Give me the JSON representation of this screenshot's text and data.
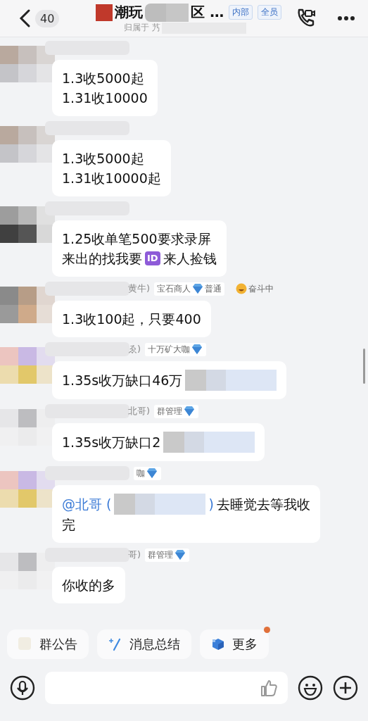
{
  "header": {
    "unread": "40",
    "title_start": "潮玩",
    "title_end": "区 …",
    "subtitle": "归属于 艿",
    "badges": [
      "内部",
      "全员"
    ]
  },
  "messages": [
    {
      "lines": [
        [
          {
            "kind": "text",
            "text": "1.3收5000起"
          }
        ],
        [
          {
            "kind": "text",
            "text": "1.31收10000"
          }
        ]
      ]
    },
    {
      "lines": [
        [
          {
            "kind": "text",
            "text": "1.3收5000起"
          }
        ],
        [
          {
            "kind": "text",
            "text": "1.31收10000起"
          }
        ]
      ]
    },
    {
      "lines": [
        [
          {
            "kind": "text",
            "text": "1.25收单笔500要求录屏"
          }
        ],
        [
          {
            "kind": "text",
            "text": "来出的找我要"
          },
          {
            "kind": "id",
            "text": "ID"
          },
          {
            "kind": "text",
            "text": "来人捡钱"
          }
        ]
      ]
    },
    {
      "sender": {
        "name": "黄牛)",
        "tag": "宝石商人",
        "tag_after": "普通",
        "status": "奋斗中"
      },
      "lines": [
        [
          {
            "kind": "text",
            "text": "1.3收100起，只要400"
          }
        ]
      ]
    },
    {
      "sender": {
        "name": "ゑ)",
        "tag": "十万矿大咖"
      },
      "lines": [
        [
          {
            "kind": "text",
            "text": "1.35s收万缺口46万"
          },
          {
            "kind": "redacted"
          }
        ]
      ]
    },
    {
      "sender": {
        "name": "北哥)",
        "tag": "群管理"
      },
      "lines": [
        [
          {
            "kind": "text",
            "text": "1.35s收万缺口2"
          },
          {
            "kind": "redacted"
          }
        ]
      ]
    },
    {
      "sender": {
        "tag": "咖"
      },
      "lines": [
        [
          {
            "kind": "mention",
            "text": "@北哥 ("
          },
          {
            "kind": "redacted"
          },
          {
            "kind": "mention",
            "text": ")"
          },
          {
            "kind": "text",
            "text": "去睡觉去等我收"
          }
        ],
        [
          {
            "kind": "text",
            "text": "完"
          }
        ]
      ]
    },
    {
      "sender": {
        "name": "哥)",
        "tag": "群管理"
      },
      "lines": [
        [
          {
            "kind": "text",
            "text": "你收的多"
          }
        ]
      ]
    }
  ],
  "quick_actions": [
    {
      "label": "群公告",
      "kind": "notice",
      "dot": false
    },
    {
      "label": "消息总结",
      "kind": "summary",
      "dot": false
    },
    {
      "label": "更多",
      "kind": "more",
      "dot": true
    }
  ]
}
